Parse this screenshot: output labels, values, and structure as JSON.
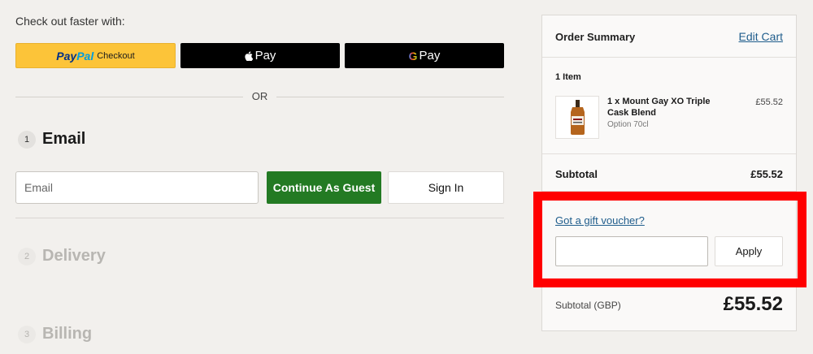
{
  "express": {
    "title": "Check out faster with:",
    "paypal_pay": "Pay",
    "paypal_pal": "Pal",
    "paypal_checkout": "Checkout",
    "applepay_label": "Pay",
    "googlepay_g": "G",
    "googlepay_label": "Pay",
    "or_text": "OR"
  },
  "steps": [
    {
      "number": "1",
      "title": "Email"
    },
    {
      "number": "2",
      "title": "Delivery"
    },
    {
      "number": "3",
      "title": "Billing"
    }
  ],
  "email": {
    "placeholder": "Email",
    "continue_guest_label": "Continue As Guest",
    "sign_in_label": "Sign In"
  },
  "summary": {
    "title": "Order Summary",
    "edit_cart_label": "Edit Cart",
    "item_count": "1 Item",
    "item": {
      "name": "1 x Mount Gay XO Triple Cask Blend",
      "option": "Option 70cl",
      "price": "£55.52"
    },
    "subtotal_label": "Subtotal",
    "subtotal_value": "£55.52",
    "voucher_link": "Got a gift voucher?",
    "apply_label": "Apply",
    "total_label": "Subtotal (GBP)",
    "total_value": "£55.52"
  },
  "colors": {
    "paypal_yellow": "#fcc439",
    "guest_green": "#237a23",
    "link_blue": "#1f5d8c",
    "highlight_red": "#ff0000"
  }
}
